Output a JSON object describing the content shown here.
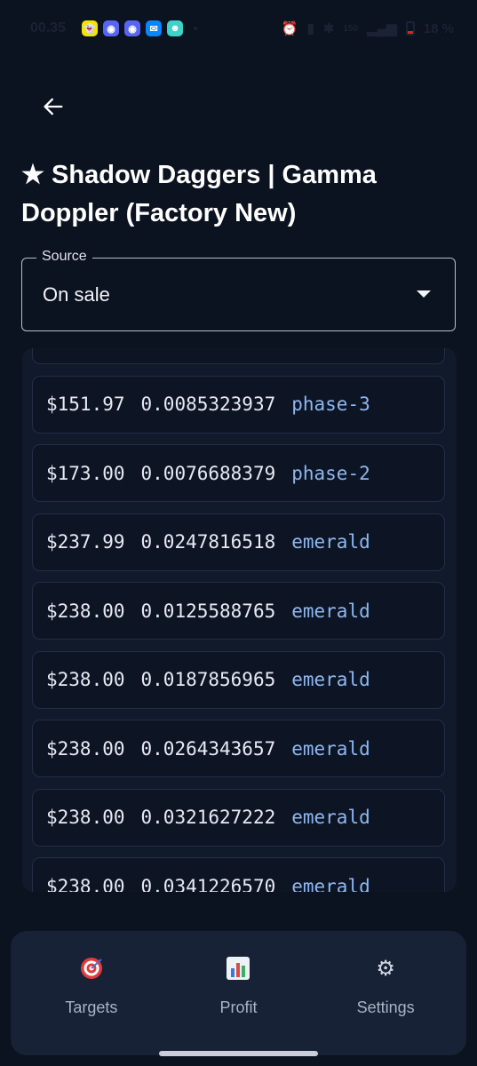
{
  "status_bar": {
    "time": "00.35",
    "network_label": "150",
    "battery_text": "18 %"
  },
  "header": {
    "back_icon": "arrow-left-icon",
    "title": "★ Shadow Daggers | Gamma Doppler (Factory New)"
  },
  "source": {
    "label": "Source",
    "value": "On sale"
  },
  "listings": [
    {
      "price": "",
      "float": "",
      "phase": ""
    },
    {
      "price": "$151.97",
      "float": "0.0085323937",
      "phase": "phase-3"
    },
    {
      "price": "$173.00",
      "float": "0.0076688379",
      "phase": "phase-2"
    },
    {
      "price": "$237.99",
      "float": "0.0247816518",
      "phase": "emerald"
    },
    {
      "price": "$238.00",
      "float": "0.0125588765",
      "phase": "emerald"
    },
    {
      "price": "$238.00",
      "float": "0.0187856965",
      "phase": "emerald"
    },
    {
      "price": "$238.00",
      "float": "0.0264343657",
      "phase": "emerald"
    },
    {
      "price": "$238.00",
      "float": "0.0321627222",
      "phase": "emerald"
    },
    {
      "price": "$238.00",
      "float": "0.0341226570",
      "phase": "emerald"
    }
  ],
  "nav": {
    "targets": "Targets",
    "profit": "Profit",
    "settings": "Settings"
  },
  "colors": {
    "background": "#0b1220",
    "panel": "#111a2b",
    "accent": "#8fb7ef",
    "nav_bar": "#172236"
  }
}
